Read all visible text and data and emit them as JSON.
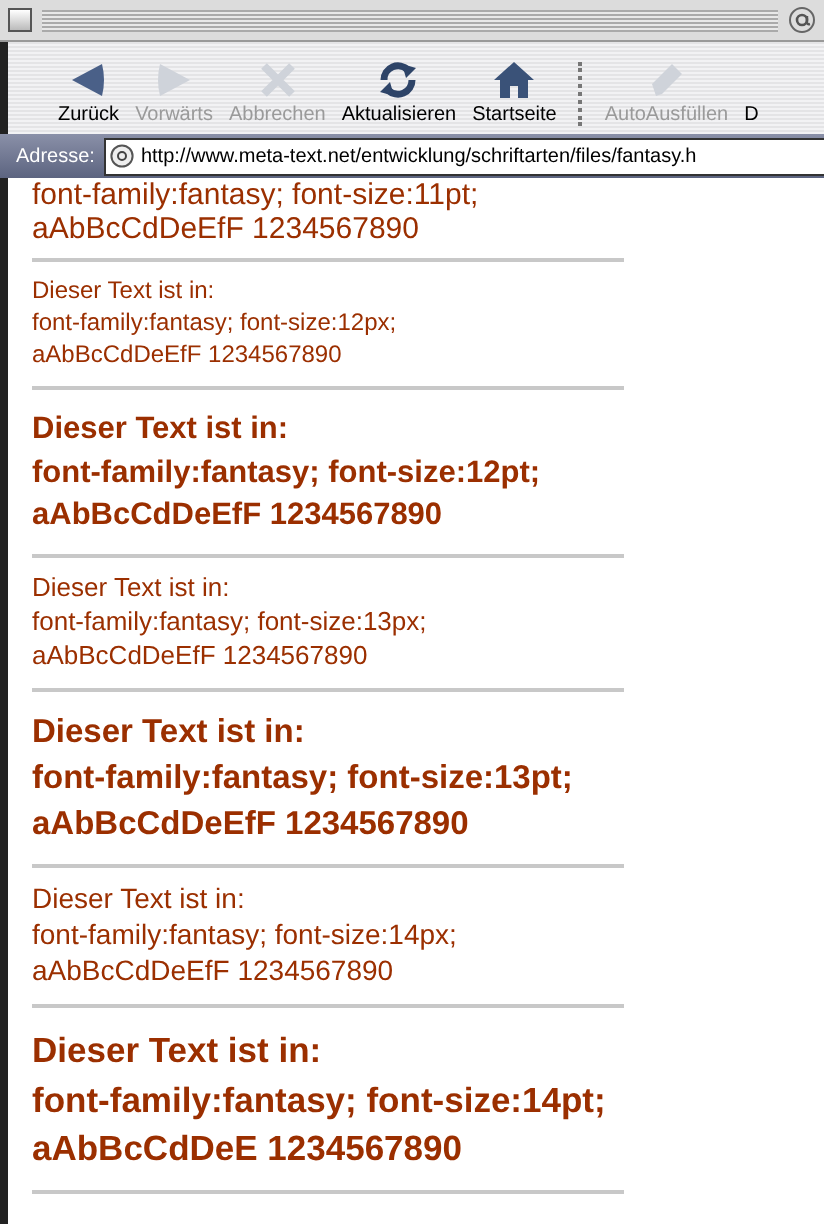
{
  "toolbar": {
    "buttons": [
      {
        "kind": "back",
        "label": "Zurück",
        "disabled": false
      },
      {
        "kind": "forward",
        "label": "Vorwärts",
        "disabled": true
      },
      {
        "kind": "stop",
        "label": "Abbrechen",
        "disabled": true
      },
      {
        "kind": "refresh",
        "label": "Aktualisieren",
        "disabled": false
      },
      {
        "kind": "home",
        "label": "Startseite",
        "disabled": false
      },
      {
        "kind": "separator"
      },
      {
        "kind": "autofill",
        "label": "AutoAusfüllen",
        "disabled": true
      },
      {
        "kind": "other",
        "label": "D",
        "disabled": false
      }
    ]
  },
  "address_bar": {
    "label": "Adresse:",
    "url": "http://www.meta-text.net/entwicklung/schriftarten/files/fantasy.h"
  },
  "content": {
    "partial_block": {
      "lines": [
        "font-family:fantasy; font-size:11pt;",
        "aAbBcCdDeEfF 1234567890"
      ]
    },
    "blocks": [
      {
        "kind": "small",
        "lines": [
          "Dieser Text ist in:",
          "font-family:fantasy; font-size:12px;",
          "aAbBcCdDeEfF 1234567890"
        ]
      },
      {
        "kind": "large",
        "lines": [
          "Dieser Text ist in:",
          "font-family:fantasy; font-size:12pt;",
          "aAbBcCdDeEfF 1234567890"
        ]
      },
      {
        "kind": "small",
        "lines": [
          "Dieser Text ist in:",
          "font-family:fantasy; font-size:13px;",
          "aAbBcCdDeEfF 1234567890"
        ]
      },
      {
        "kind": "large",
        "lines": [
          "Dieser Text ist in:",
          "font-family:fantasy; font-size:13pt;",
          "aAbBcCdDeEfF 1234567890"
        ]
      },
      {
        "kind": "small",
        "lines": [
          "Dieser Text ist in:",
          "font-family:fantasy; font-size:14px;",
          "aAbBcCdDeEfF 1234567890"
        ]
      },
      {
        "kind": "large",
        "lines": [
          "Dieser Text ist in:",
          "font-family:fantasy; font-size:14pt;",
          "aAbBcCdDeE 1234567890"
        ]
      }
    ]
  }
}
